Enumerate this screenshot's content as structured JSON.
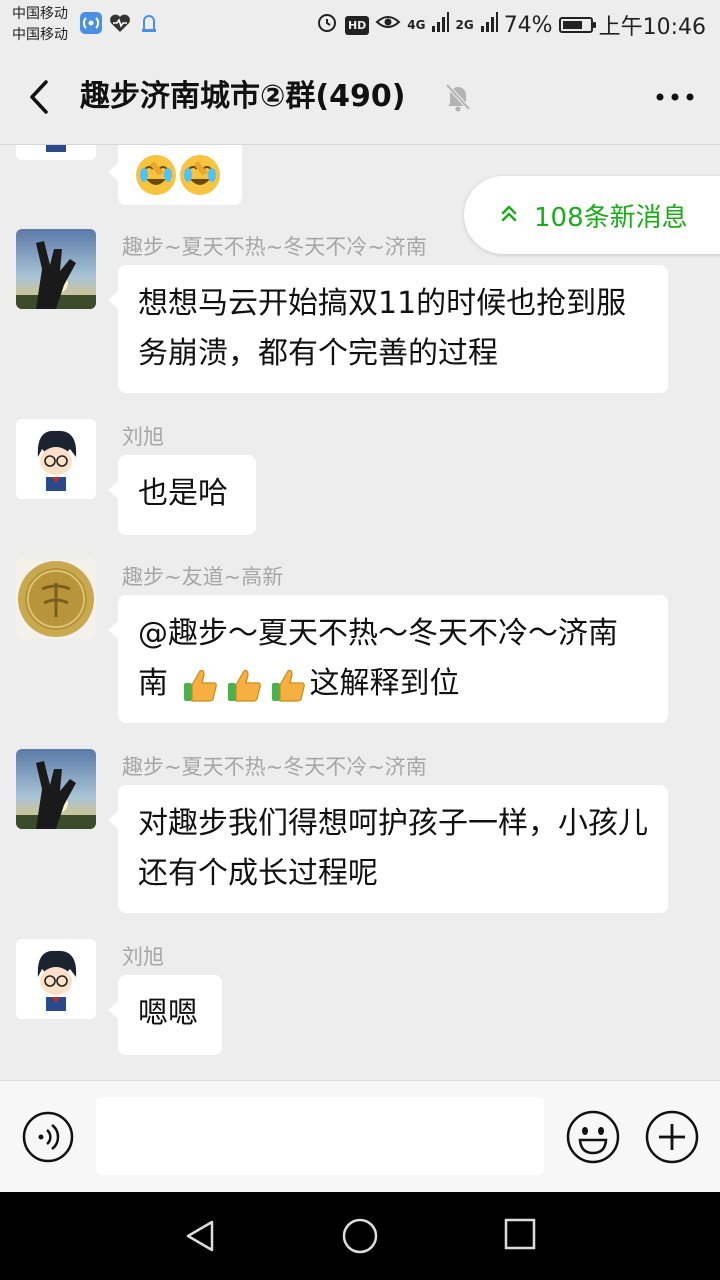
{
  "status_bar": {
    "carrier_1": "中国移动",
    "carrier_2": "中国移动",
    "hd_label": "HD",
    "net_1": "4G",
    "net_2": "2G",
    "battery_text": "74%",
    "battery_level": 0.74,
    "time": "上午10:46"
  },
  "header": {
    "title": "趣步济南城市②群(490)",
    "icons": [
      "back-icon",
      "mute-bell-icon",
      "more-icon"
    ]
  },
  "new_messages": {
    "label": "108条新消息",
    "icon": "double-chevron-up-icon",
    "color": "#1aad19"
  },
  "messages": [
    {
      "sender": "",
      "text": "",
      "avatar": "avatar-conan",
      "emoji": [
        "facepalm-laugh-emoji",
        "facepalm-laugh-emoji"
      ]
    },
    {
      "sender": "趣步~夏天不热~冬天不冷~济南",
      "text": "想想马云开始搞双11的时候也抢到服务崩溃，都有个完善的过程",
      "avatar": "avatar-hand-sunset"
    },
    {
      "sender": "刘旭",
      "text": "也是哈",
      "avatar": "avatar-conan"
    },
    {
      "sender": "趣步~友道~高新",
      "text": "@趣步～夏天不热～冬天不冷～济南",
      "text_line2": "这解释到位",
      "thumbs": 3,
      "avatar": "avatar-gold-coin"
    },
    {
      "sender": "趣步~夏天不热~冬天不冷~济南",
      "text": "对趣步我们得想呵护孩子一样，小孩儿还有个成长过程呢",
      "avatar": "avatar-hand-sunset"
    },
    {
      "sender": "刘旭",
      "text": "嗯嗯",
      "avatar": "avatar-conan"
    }
  ],
  "input_bar": {
    "value": "",
    "icons": [
      "voice-icon",
      "emoji-icon",
      "plus-icon"
    ]
  },
  "system_nav": [
    "nav-back-icon",
    "nav-home-icon",
    "nav-recent-icon"
  ],
  "colors": {
    "background": "#ededed",
    "bubble": "#ffffff",
    "accent_green": "#1aad19",
    "sender_gray": "#a6a6a6"
  }
}
